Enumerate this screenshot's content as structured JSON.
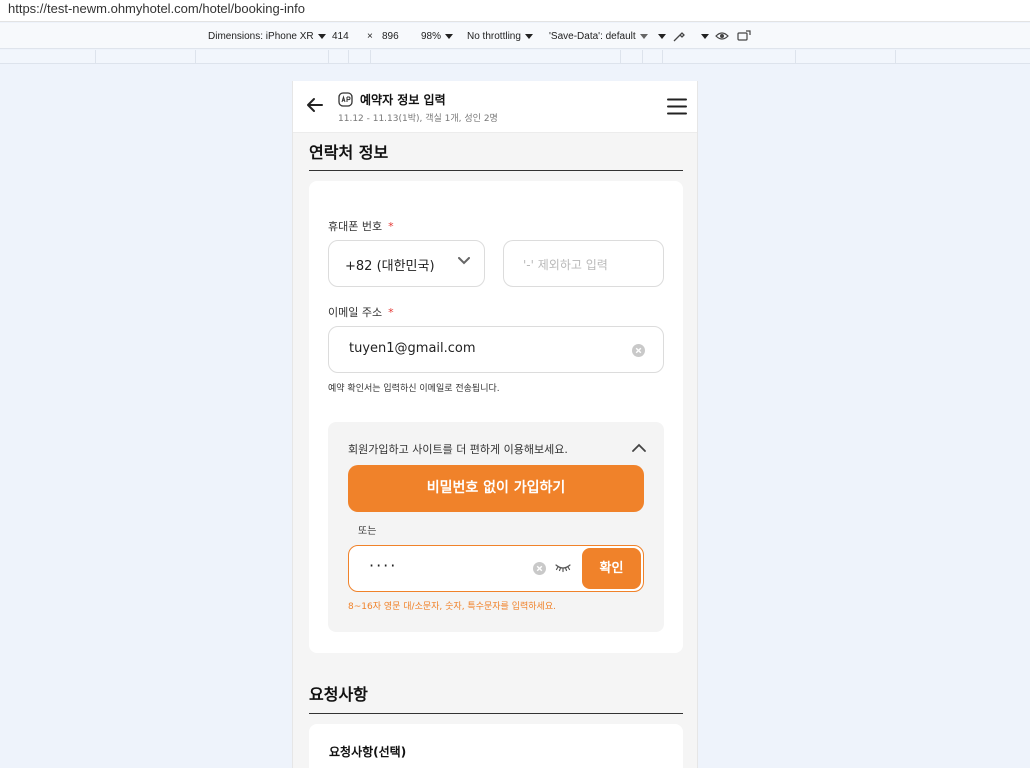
{
  "browser": {
    "url": "https://test-newm.ohmyhotel.com/hotel/booking-info"
  },
  "devtools": {
    "dimensions_label": "Dimensions: iPhone XR",
    "width": "414",
    "times": "×",
    "height": "896",
    "zoom": "98%",
    "throttling": "No throttling",
    "save_data": "'Save-Data': default"
  },
  "header": {
    "title": "예약자 정보 입력",
    "subtitle": "11.12 - 11.13(1박), 객실 1개, 성인 2명"
  },
  "contact": {
    "section_title": "연락처 정보",
    "phone_label": "휴대폰 번호",
    "required_mark": "*",
    "country_code": "+82 (대한민국)",
    "phone_placeholder": "'-' 제외하고 입력",
    "email_label": "이메일 주소",
    "email_value": "tuyen1@gmail.com",
    "email_hint": "예약 확인서는 입력하신 이메일로 전송됩니다.",
    "signup": {
      "prompt": "회원가입하고 사이트를 더 편하게 이용해보세요.",
      "join_button": "비밀번호 없이 가입하기",
      "or": "또는",
      "password_masked": "····",
      "confirm_button": "확인",
      "password_rule": "8~16자 영문 대/소문자, 숫자, 특수문자를 입력하세요."
    }
  },
  "requests": {
    "section_title": "요청사항",
    "card_title": "요청사항(선택)"
  },
  "colors": {
    "accent": "#f0822a",
    "required": "#e53935",
    "background": "#f5f5f5"
  }
}
